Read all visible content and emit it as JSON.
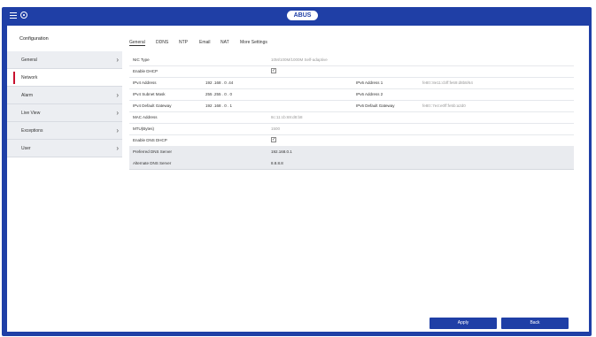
{
  "brand": "ABUS",
  "sidebar": {
    "title": "Configuration",
    "items": [
      {
        "label": "General",
        "has_chevron": true,
        "active": false
      },
      {
        "label": "Network",
        "has_chevron": false,
        "active": true
      },
      {
        "label": "Alarm",
        "has_chevron": true,
        "active": false
      },
      {
        "label": "Live View",
        "has_chevron": true,
        "active": false
      },
      {
        "label": "Exceptions",
        "has_chevron": true,
        "active": false
      },
      {
        "label": "User",
        "has_chevron": true,
        "active": false
      }
    ]
  },
  "tabs": [
    "General",
    "DDNS",
    "NTP",
    "Email",
    "NAT",
    "More Settings"
  ],
  "active_tab": "General",
  "form": {
    "nic_type_label": "NIC Type",
    "nic_type_value": "10M/100M/1000M Self-adaptive",
    "dhcp_label": "Enable DHCP",
    "ipv4_address_label": "IPv4 Address",
    "ipv4_address_value": "192 .168 . 0   .44",
    "ipv4_mask_label": "IPv4 Subnet Mask",
    "ipv4_mask_value": "255 .255 . 0   . 0",
    "ipv4_gateway_label": "IPv4 Default Gateway",
    "ipv4_gateway_value": "192 .168 . 0   . 1",
    "ipv6_addr1_label": "IPv6 Address 1",
    "ipv6_addr1_value": "fe80::8e11:cbff:fe69:d8b8/64",
    "ipv6_addr2_label": "IPv6 Address 2",
    "ipv6_gateway_label": "IPv6 Default Gateway",
    "ipv6_gateway_value": "fe80::7e4:e0ff:fe5b:a2d0",
    "mac_label": "MAC Address",
    "mac_value": "8c:11:cb:69:d8:b8",
    "mtu_label": "MTU(Bytes)",
    "mtu_value": "1500",
    "dns_dhcp_label": "Enable DNS DHCP",
    "dns_pref_label": "Preferred DNS Server",
    "dns_pref_value": "192.168.0.1",
    "dns_alt_label": "Alternate DNS Server",
    "dns_alt_value": "8.8.8.8"
  },
  "buttons": {
    "apply": "Apply",
    "back": "Back"
  },
  "colors": {
    "frame": "#1f3fa6",
    "accent": "#c8102e"
  }
}
